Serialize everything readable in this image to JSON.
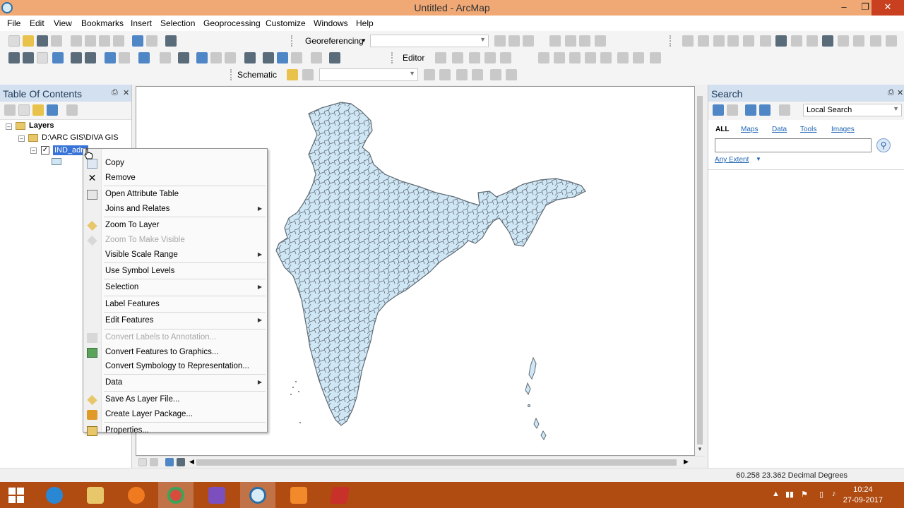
{
  "window": {
    "title": "Untitled - ArcMap"
  },
  "menu": [
    "File",
    "Edit",
    "View",
    "Bookmarks",
    "Insert",
    "Selection",
    "Geoprocessing",
    "Customize",
    "Windows",
    "Help"
  ],
  "toolbars": {
    "georeferencing_label": "Georeferencing",
    "editor_label": "Editor",
    "schematic_label": "Schematic"
  },
  "toc": {
    "title": "Table Of Contents",
    "root": "Layers",
    "folder": "D:\\ARC GIS\\DIVA GIS",
    "layer": "IND_adm",
    "layer_checked": true
  },
  "context_menu": [
    {
      "label": "Copy",
      "icon": "copy-icon",
      "enabled": true,
      "submenu": false
    },
    {
      "label": "Remove",
      "icon": "remove-icon",
      "enabled": true,
      "submenu": false
    },
    {
      "label": "Open Attribute Table",
      "icon": "table-icon",
      "enabled": true,
      "submenu": false
    },
    {
      "label": "Joins and Relates",
      "icon": "",
      "enabled": true,
      "submenu": true
    },
    {
      "label": "Zoom To Layer",
      "icon": "zoom-layer-icon",
      "enabled": true,
      "submenu": false
    },
    {
      "label": "Zoom To Make Visible",
      "icon": "zoom-visible-icon",
      "enabled": false,
      "submenu": false
    },
    {
      "label": "Visible Scale Range",
      "icon": "",
      "enabled": true,
      "submenu": true
    },
    {
      "label": "Use Symbol Levels",
      "icon": "",
      "enabled": true,
      "submenu": false
    },
    {
      "label": "Selection",
      "icon": "",
      "enabled": true,
      "submenu": true
    },
    {
      "label": "Label Features",
      "icon": "",
      "enabled": true,
      "submenu": false
    },
    {
      "label": "Edit Features",
      "icon": "",
      "enabled": true,
      "submenu": true
    },
    {
      "label": "Convert Labels to Annotation...",
      "icon": "annotation-icon",
      "enabled": false,
      "submenu": false
    },
    {
      "label": "Convert Features to Graphics...",
      "icon": "graphics-icon",
      "enabled": true,
      "submenu": false
    },
    {
      "label": "Convert Symbology to Representation...",
      "icon": "",
      "enabled": true,
      "submenu": false
    },
    {
      "label": "Data",
      "icon": "",
      "enabled": true,
      "submenu": true
    },
    {
      "label": "Save As Layer File...",
      "icon": "layer-file-icon",
      "enabled": true,
      "submenu": false
    },
    {
      "label": "Create Layer Package...",
      "icon": "layer-package-icon",
      "enabled": true,
      "submenu": false
    },
    {
      "label": "Properties...",
      "icon": "properties-icon",
      "enabled": true,
      "submenu": false
    }
  ],
  "search": {
    "title": "Search",
    "scope": "Local Search",
    "tabs": [
      "ALL",
      "Maps",
      "Data",
      "Tools",
      "Images"
    ],
    "query": "",
    "extent": "Any Extent"
  },
  "status": {
    "coordinates": "60.258  23.362 Decimal Degrees"
  },
  "taskbar": {
    "time": "10:24",
    "date": "27-09-2017"
  },
  "colors": {
    "titlebar": "#f0a875",
    "taskbar": "#b04b12",
    "selection": "#3874d8",
    "map_fill": "#cfe6f5",
    "map_stroke": "#5f6b74"
  }
}
